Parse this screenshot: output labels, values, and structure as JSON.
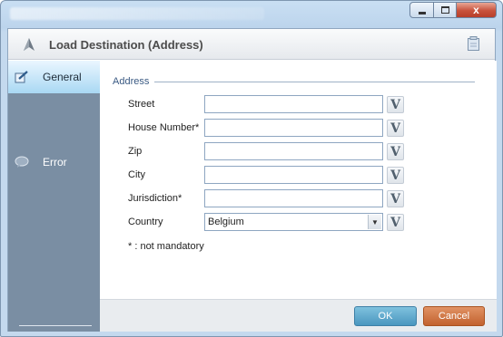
{
  "window": {
    "controls": {
      "minimize": "minimize",
      "maximize": "maximize",
      "close": "x"
    }
  },
  "header": {
    "title": "Load Destination (Address)",
    "icon": "navigate-arrow-icon",
    "doc_icon": "document-icon"
  },
  "sidebar": {
    "items": [
      {
        "label": "General",
        "icon": "edit-form-icon",
        "active": true
      },
      {
        "label": "Error",
        "icon": "speech-bubble-icon",
        "active": false
      }
    ]
  },
  "form": {
    "group_label": "Address",
    "fields": [
      {
        "label": "Street",
        "value": ""
      },
      {
        "label": "House Number*",
        "value": ""
      },
      {
        "label": "Zip",
        "value": ""
      },
      {
        "label": "City",
        "value": ""
      },
      {
        "label": "Jurisdiction*",
        "value": ""
      }
    ],
    "country": {
      "label": "Country",
      "selected": "Belgium"
    },
    "v_button_label": "V",
    "note": "* : not mandatory"
  },
  "footer": {
    "ok_label": "OK",
    "cancel_label": "Cancel"
  },
  "colors": {
    "sidebar": "#7a8ea3",
    "ok_button": "#4a97bf",
    "cancel_button": "#c2622f",
    "group_label": "#3a5a83"
  }
}
